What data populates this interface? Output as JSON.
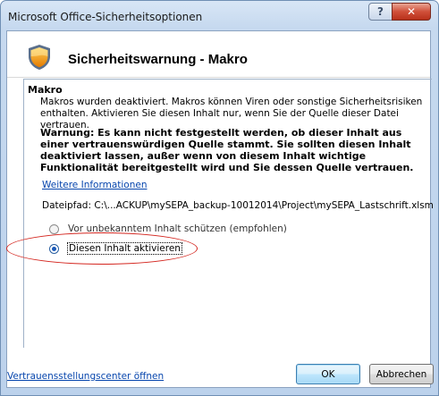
{
  "window": {
    "title": "Microsoft Office-Sicherheitsoptionen",
    "help_label": "?",
    "close_label": "✕"
  },
  "header": {
    "title": "Sicherheitswarnung - Makro",
    "icon": "shield-icon"
  },
  "section": {
    "title": "Makro",
    "description": "Makros wurden deaktiviert. Makros können Viren oder sonstige Sicherheitsrisiken enthalten. Aktivieren Sie diesen Inhalt nur, wenn Sie der Quelle dieser Datei vertrauen.",
    "warning": "Warnung: Es kann nicht festgestellt werden, ob dieser Inhalt aus einer vertrauenswürdigen Quelle stammt. Sie sollten diesen Inhalt deaktiviert lassen, außer wenn von diesem Inhalt wichtige Funktionalität bereitgestellt wird und Sie dessen Quelle vertrauen.",
    "more_info_link": "Weitere Informationen",
    "filepath": "Dateipfad:  C:\\...ACKUP\\mySEPA_backup-10012014\\Project\\mySEPA_Lastschrift.xlsm"
  },
  "options": [
    {
      "label": "Vor unbekanntem Inhalt schützen (empfohlen)",
      "selected": false
    },
    {
      "label": "Diesen Inhalt aktivieren",
      "selected": true
    }
  ],
  "footer": {
    "trust_center_link": "Vertrauensstellungscenter öffnen",
    "ok_label": "OK",
    "cancel_label": "Abbrechen"
  },
  "colors": {
    "annotation": "#d4261f",
    "link": "#0645ad",
    "shield": "#f0a020"
  }
}
